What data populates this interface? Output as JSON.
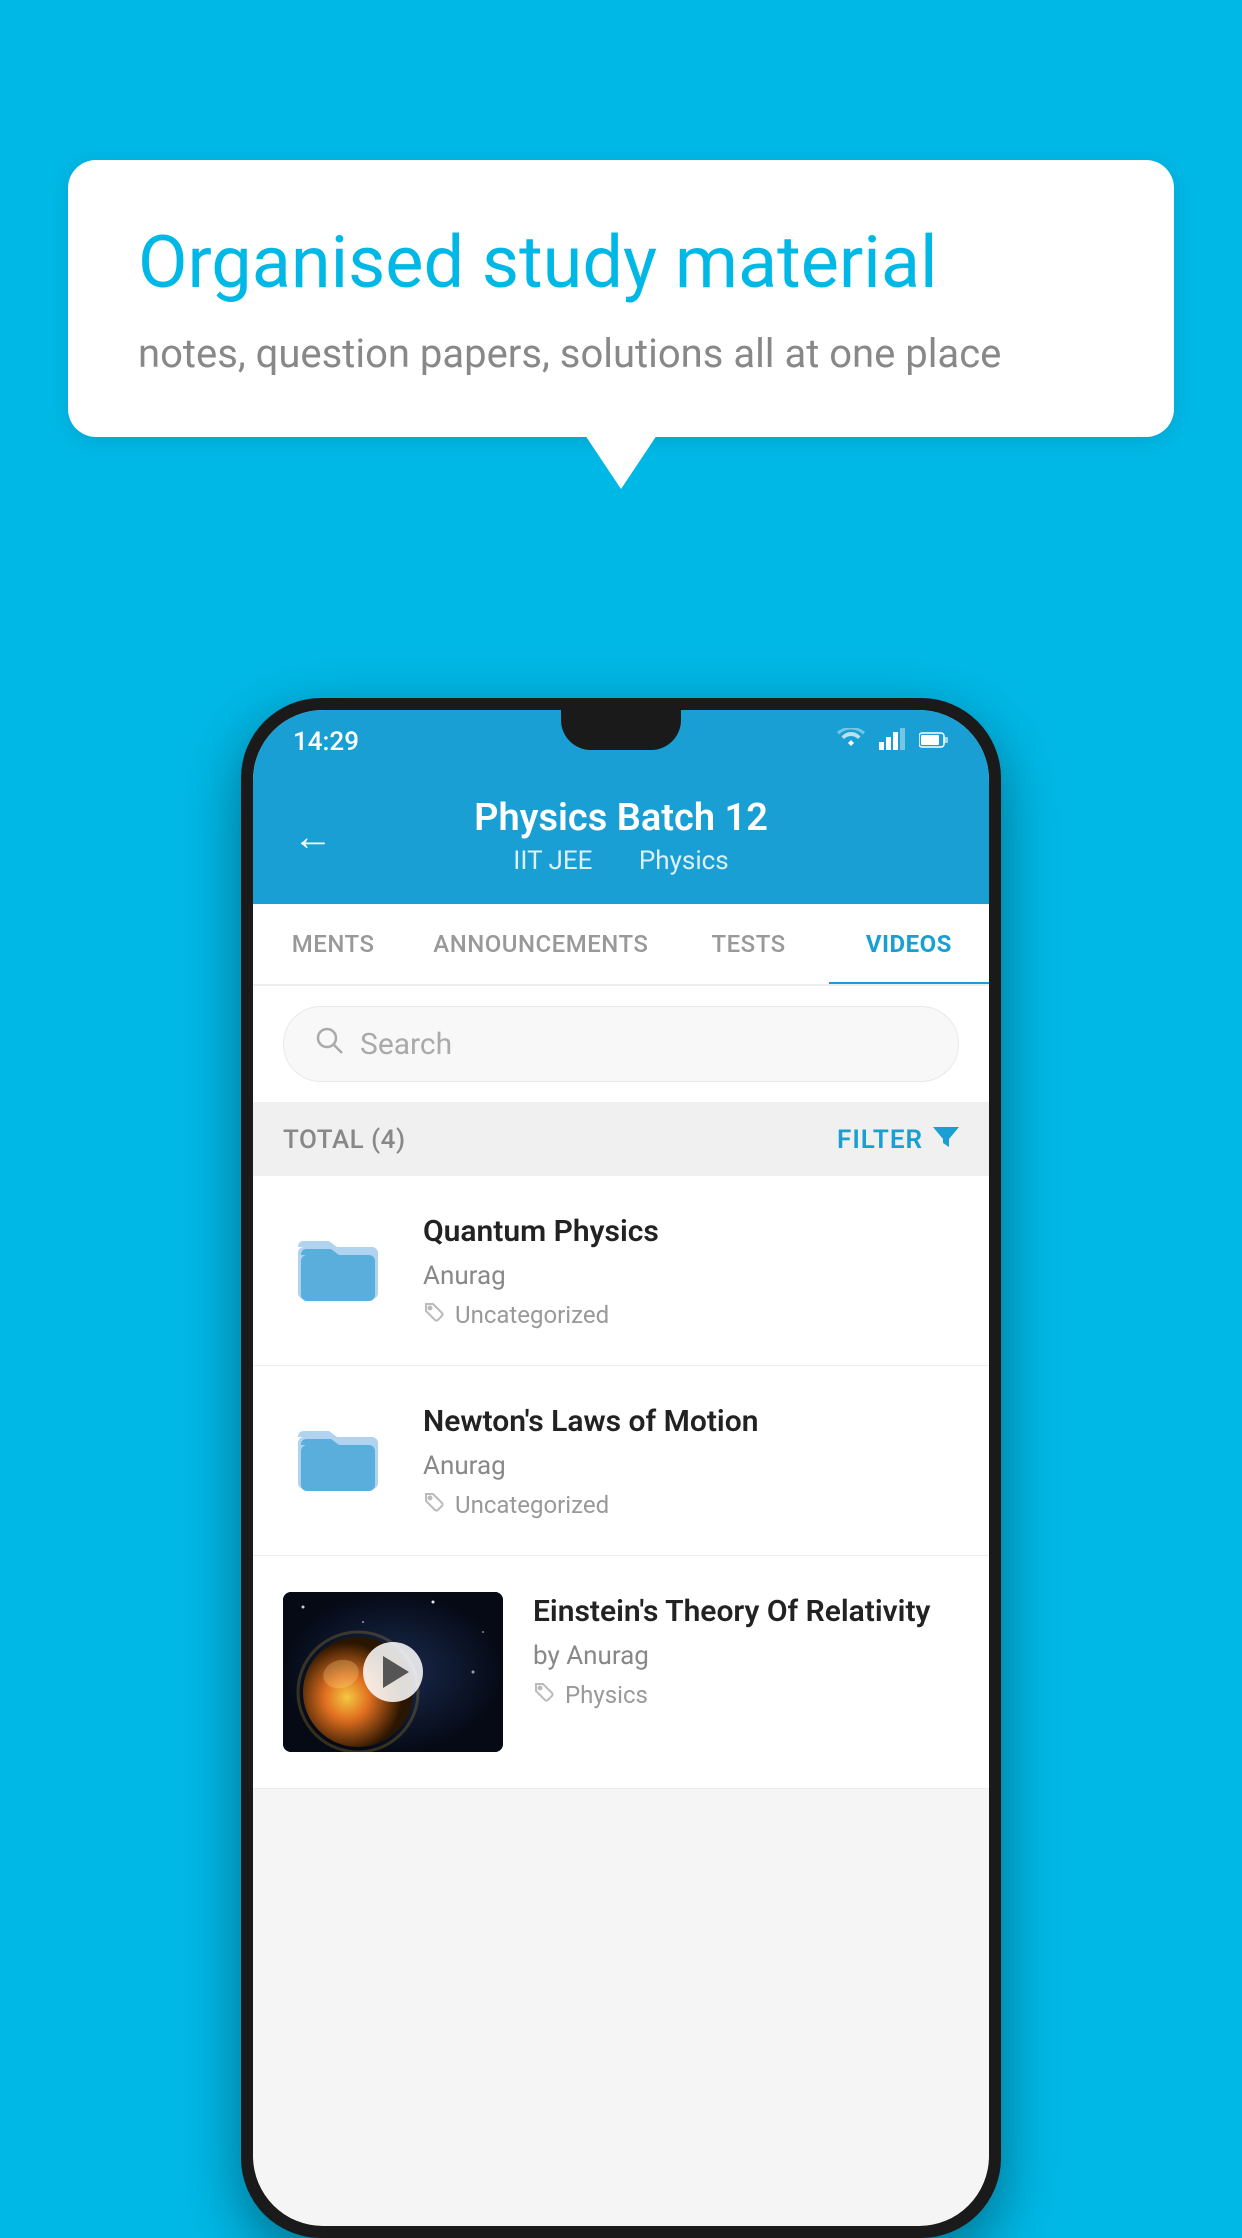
{
  "background_color": "#00b8e6",
  "speech_bubble": {
    "title": "Organised study material",
    "subtitle": "notes, question papers, solutions all at one place"
  },
  "phone": {
    "status_bar": {
      "time": "14:29",
      "icons": [
        "wifi",
        "signal",
        "battery"
      ]
    },
    "header": {
      "back_label": "←",
      "title": "Physics Batch 12",
      "tag1": "IIT JEE",
      "tag2": "Physics"
    },
    "tabs": [
      {
        "label": "MENTS",
        "active": false
      },
      {
        "label": "ANNOUNCEMENTS",
        "active": false
      },
      {
        "label": "TESTS",
        "active": false
      },
      {
        "label": "VIDEOS",
        "active": true
      }
    ],
    "search": {
      "placeholder": "Search"
    },
    "filter_row": {
      "total_label": "TOTAL (4)",
      "filter_label": "FILTER"
    },
    "videos": [
      {
        "title": "Quantum Physics",
        "author": "Anurag",
        "tag": "Uncategorized",
        "type": "folder"
      },
      {
        "title": "Newton's Laws of Motion",
        "author": "Anurag",
        "tag": "Uncategorized",
        "type": "folder"
      },
      {
        "title": "Einstein's Theory Of Relativity",
        "author": "by Anurag",
        "tag": "Physics",
        "type": "video"
      }
    ]
  }
}
